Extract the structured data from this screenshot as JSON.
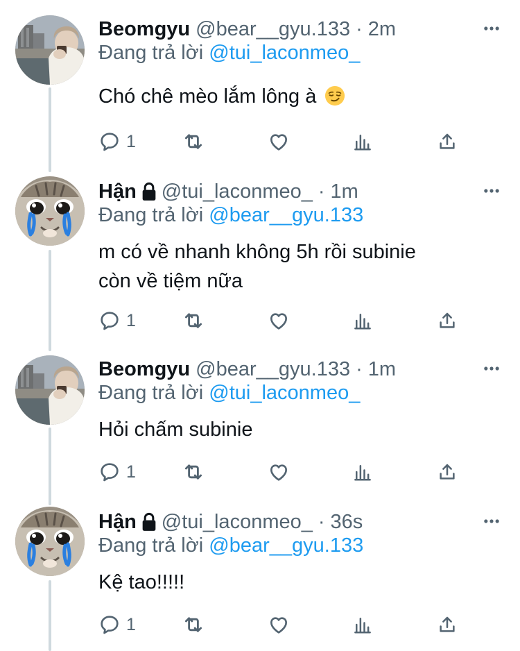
{
  "reply_prefix": "Đang trả lời",
  "tweets": [
    {
      "display_name": "Beomgyu",
      "handle": "@bear__gyu.133",
      "dot": "·",
      "time": "2m",
      "reply_to": "@tui_laconmeo_",
      "text": "Chó chê mèo lắm lông à",
      "emoji": "smirking-face",
      "reply_count": "1",
      "avatar": "beomgyu-photo",
      "locked": false
    },
    {
      "display_name": "Hận",
      "handle": "@tui_laconmeo_",
      "dot": "·",
      "time": "1m",
      "reply_to": "@bear__gyu.133",
      "text_line1": "m có về nhanh không 5h rồi subinie",
      "text_line2": "còn về tiệm nữa",
      "reply_count": "1",
      "avatar": "crying-cat",
      "locked": true
    },
    {
      "display_name": "Beomgyu",
      "handle": "@bear__gyu.133",
      "dot": "·",
      "time": "1m",
      "reply_to": "@tui_laconmeo_",
      "text": "Hỏi chấm subinie",
      "reply_count": "1",
      "avatar": "beomgyu-photo",
      "locked": false
    },
    {
      "display_name": "Hận",
      "handle": "@tui_laconmeo_",
      "dot": "·",
      "time": "36s",
      "reply_to": "@bear__gyu.133",
      "text": "Kệ tao!!!!!",
      "reply_count": "1",
      "avatar": "crying-cat",
      "locked": true
    }
  ],
  "icons": {
    "reply": "reply-icon",
    "retweet": "retweet-icon",
    "like": "heart-icon",
    "views": "views-icon",
    "share": "share-icon",
    "more": "more-icon",
    "lock": "lock-icon"
  },
  "colors": {
    "link": "#1d9bf0",
    "secondary": "#536471",
    "primary_text": "#0f1419",
    "thread_line": "#cfd9de"
  }
}
